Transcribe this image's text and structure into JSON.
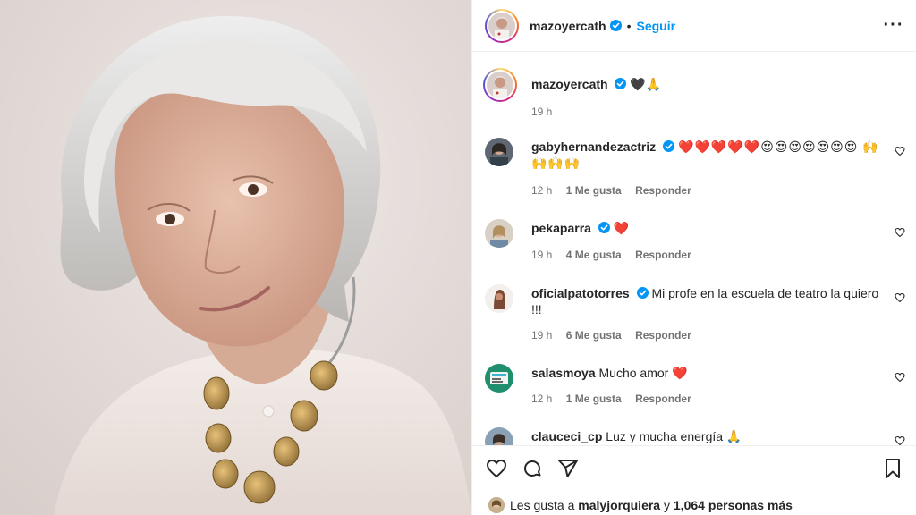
{
  "post": {
    "author": "mazoyercath",
    "follow_label": "Seguir",
    "separator": "•",
    "more_icon": "more-options-icon"
  },
  "caption": {
    "user": "mazoyercath",
    "text": "🖤🙏",
    "time": "19 h"
  },
  "comments": [
    {
      "user": "gabyhernandezactriz",
      "text": "❤️❤️❤️❤️❤️😍😍😍😍😍😍😍 🙌🙌🙌🙌",
      "time": "12 h",
      "likes": "1 Me gusta",
      "reply": "Responder"
    },
    {
      "user": "pekaparra",
      "text": "❤️",
      "time": "19 h",
      "likes": "4 Me gusta",
      "reply": "Responder"
    },
    {
      "user": "oficialpatotorres",
      "text": "Mi profe en la escuela de teatro la quiero !!!",
      "time": "19 h",
      "likes": "6 Me gusta",
      "reply": "Responder"
    },
    {
      "user": "salasmoya",
      "text": "Mucho amor ❤️",
      "time": "12 h",
      "likes": "1 Me gusta",
      "reply": "Responder"
    },
    {
      "user": "clauceci_cp",
      "text": "Luz y mucha energía 🙏",
      "time": "",
      "likes": "",
      "reply": ""
    }
  ],
  "likes_line": {
    "prefix": "Les gusta a",
    "user": "malyjorquiera",
    "conj": "y",
    "count": "1,064 personas más"
  },
  "colors": {
    "accent": "#0095f6",
    "heart": "#ed4956",
    "muted": "#737373",
    "verified": "#0095f6"
  }
}
